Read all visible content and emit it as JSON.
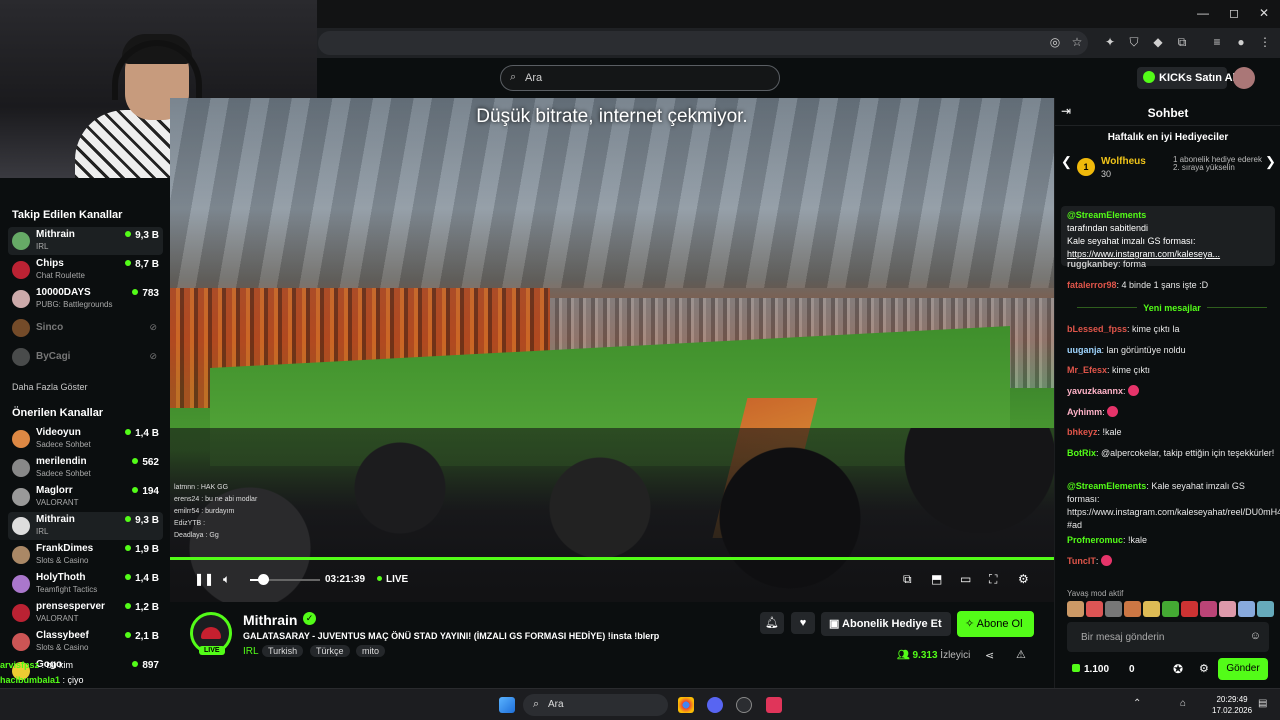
{
  "search": {
    "placeholder": "Ara"
  },
  "topbar": {
    "kicks_button": "KICKs Satın Al"
  },
  "video": {
    "overlay_text": "Düşük bitrate, internet çekmiyor.",
    "time": "03:21:39",
    "live_label": "LIVE",
    "chat_overlay": [
      "latmnn : HAK GG",
      "erens24 : bu ne abi modlar",
      "emilrr54 : burdayım",
      "EdizYTB : ",
      "Deadlaya : Gg"
    ]
  },
  "sidebar": {
    "followed_title": "Takip Edilen Kanallar",
    "followed": [
      {
        "name": "Mithrain",
        "category": "IRL",
        "viewers": "9,3 B",
        "active": true
      },
      {
        "name": "Chips",
        "category": "Chat Roulette",
        "viewers": "8,7 B"
      },
      {
        "name": "10000DAYS",
        "category": "PUBG: Battlegrounds",
        "viewers": "783"
      },
      {
        "name": "Sinco",
        "offline": true
      },
      {
        "name": "ByCagi",
        "offline": true
      }
    ],
    "show_more": "Daha Fazla Göster",
    "recommended_title": "Önerilen Kanallar",
    "recommended": [
      {
        "name": "Videoyun",
        "category": "Sadece Sohbet",
        "viewers": "1,4 B"
      },
      {
        "name": "merilendin",
        "category": "Sadece Sohbet",
        "viewers": "562"
      },
      {
        "name": "Maglorr",
        "category": "VALORANT",
        "viewers": "194"
      },
      {
        "name": "Mithrain",
        "category": "IRL",
        "viewers": "9,3 B",
        "active": true
      },
      {
        "name": "FrankDimes",
        "category": "Slots & Casino",
        "viewers": "1,9 B"
      },
      {
        "name": "HolyThoth",
        "category": "Teamfight Tactics",
        "viewers": "1,4 B"
      },
      {
        "name": "prensesperver",
        "category": "VALORANT",
        "viewers": "1,2 B"
      },
      {
        "name": "Classybeef",
        "category": "Slots & Casino",
        "viewers": "2,1 B"
      },
      {
        "name": "Gogo",
        "category": "",
        "viewers": "897"
      }
    ]
  },
  "stream": {
    "channel": "Mithrain",
    "live_badge": "LIVE",
    "title": "GALATASARAY - JUVENTUS MAÇ ÖNÜ STAD YAYINI! (İMZALI GS FORMASI HEDİYE) !insta !blerp",
    "category": "IRL",
    "tags": [
      "Turkish",
      "Türkçe",
      "mito"
    ],
    "gift_button": "Abonelik Hediye Et",
    "subscribe_button": "Abone Ol",
    "viewers": "9.313",
    "viewers_label": "İzleyici"
  },
  "chat": {
    "title": "Sohbet",
    "gifters_title": "Haftalık en iyi Hediyeciler",
    "top_gifter": {
      "rank": "1",
      "name": "Wolfheus",
      "count": "30",
      "next": "1 abonelik hediye ederek 2. sıraya yükselin"
    },
    "pinned": {
      "user": "@StreamElements",
      "by": "tarafından sabitlendi",
      "text": "Kale seyahat imzalı GS forması:",
      "link": "https://www.instagram.com/kaleseya..."
    },
    "messages_before": [
      {
        "user": "ruggkanbey",
        "text": "forma",
        "color": "#c9c9c9"
      },
      {
        "user": "fatalerror98",
        "text": "4 binde 1 şans işte :D",
        "color": "#e0554a"
      }
    ],
    "new_label": "Yeni mesajlar",
    "messages": [
      {
        "user": "bLessed_fpss",
        "text": "kime çıktı la",
        "color": "#e0554a"
      },
      {
        "user": "uuganja",
        "text": "lan görüntüye noldu",
        "color": "#9fd5ff"
      },
      {
        "user": "Mr_Efesx",
        "text": "kime çıktı",
        "color": "#e0554a"
      },
      {
        "user": "yavuzkaannx",
        "text": "",
        "color": "#ffb3c8",
        "emote": true
      },
      {
        "user": "Ayhimm",
        "text": "",
        "color": "#ffb3c8",
        "emote": true
      },
      {
        "user": "bhkeyz",
        "text": "!kale",
        "color": "#e0554a"
      },
      {
        "user": "BotRix",
        "text": "@alpercokelar, takip ettiğin için teşekkürler!",
        "color": "#53fc18"
      },
      {
        "user": "@StreamElements",
        "text": "Kale seyahat imzalı GS forması: https://www.instagram.com/kaleseyahat/reel/DU0mH47Asic/ #ad",
        "color": "#53fc18"
      },
      {
        "user": "Profneromuc",
        "text": "!kale",
        "color": "#53fc18"
      },
      {
        "user": "TuncIT",
        "text": "",
        "color": "#e0554a",
        "emote": true
      }
    ],
    "slow_mode": "Yavaş mod aktif",
    "input_placeholder": "Bir mesaj gönderin",
    "kicks_count": "1.100",
    "zero_count": "0",
    "send_button": "Gönder"
  },
  "overlay_chat": [
    {
      "user": "arvisfpsz",
      "text": "bu kim"
    },
    {
      "user": "hacibumbala1",
      "text": "çiyo"
    }
  ],
  "taskbar": {
    "search_placeholder": "Ara",
    "time": "20:29:49",
    "date": "17.02.2026"
  },
  "colors": {
    "accent": "#53fc18",
    "background": "#0b0e0f",
    "gifter_gold": "#f0c419"
  }
}
